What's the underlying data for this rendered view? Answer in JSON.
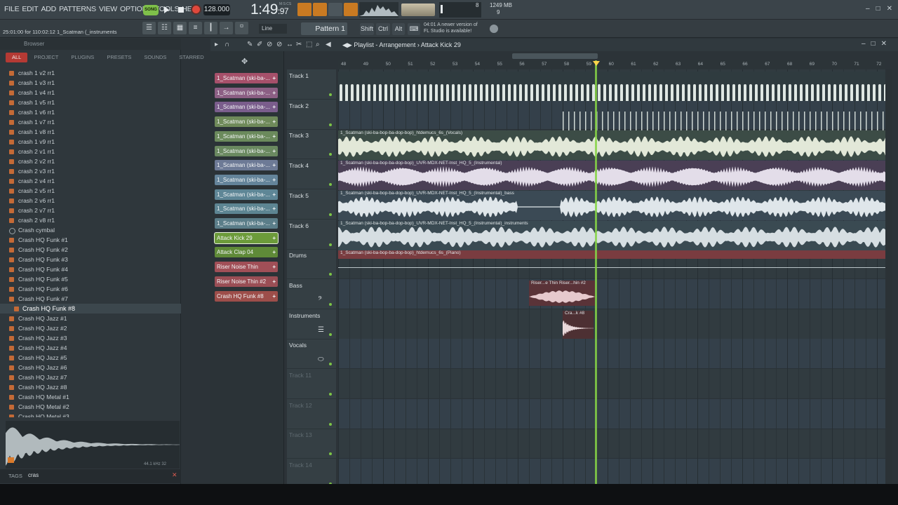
{
  "menu": [
    "FILE",
    "EDIT",
    "ADD",
    "PATTERNS",
    "VIEW",
    "OPTIONS",
    "TOOLS",
    "HELP"
  ],
  "transport": {
    "song_mode": "SONG",
    "tempo": "128.000",
    "time_main": "1:49",
    "time_sub": "97",
    "time_unit": "M:S:CS",
    "cpu_value": "8",
    "poly_value": "9",
    "memory": "1249 MB"
  },
  "toolbar": {
    "hint": "25:01:00 for 110:02:12  1_Scatman (_instruments",
    "snap": "Line",
    "pattern": "Pattern 1",
    "shift": "Shift",
    "ctrl": "Ctrl",
    "alt": "Alt",
    "news_line1": "04:01  A newer version of",
    "news_line2": "FL Studio is available!"
  },
  "browser": {
    "title": "Browser",
    "tabs": [
      "ALL",
      "PROJECT",
      "PLUGINS",
      "PRESETS",
      "SOUNDS",
      "STARRED"
    ],
    "items": [
      "crash 1 v2 rr1",
      "crash 1 v3 rr1",
      "crash 1 v4 rr1",
      "crash 1 v5 rr1",
      "crash 1 v6 rr1",
      "crash 1 v7 rr1",
      "crash 1 v8 rr1",
      "crash 1 v9 rr1",
      "crash 2 v1 rr1",
      "crash 2 v2 rr1",
      "crash 2 v3 rr1",
      "crash 2 v4 rr1",
      "crash 2 v5 rr1",
      "crash 2 v6 rr1",
      "crash 2 v7 rr1",
      "crash 2 v8 rr1",
      "Crash cymbal",
      "Crash HQ Funk #1",
      "Crash HQ Funk #2",
      "Crash HQ Funk #3",
      "Crash HQ Funk #4",
      "Crash HQ Funk #5",
      "Crash HQ Funk #6",
      "Crash HQ Funk #7",
      "Crash HQ Funk #8",
      "Crash HQ Jazz #1",
      "Crash HQ Jazz #2",
      "Crash HQ Jazz #3",
      "Crash HQ Jazz #4",
      "Crash HQ Jazz #5",
      "Crash HQ Jazz #6",
      "Crash HQ Jazz #7",
      "Crash HQ Jazz #8",
      "Crash HQ Metal #1",
      "Crash HQ Metal #2",
      "Crash HQ Metal #3"
    ],
    "selected_index": 24,
    "folder_index": 16,
    "preview_info": "44.1 kHz 32",
    "search_label": "TAGS",
    "search_value": "cras"
  },
  "playlist": {
    "title": "Playlist - Arrangement",
    "current_clip": "Attack Kick 29",
    "picker": [
      {
        "label": "1_Scatman (ski-ba-...",
        "color": "#a6506a"
      },
      {
        "label": "1_Scatman (ski-ba-...",
        "color": "#8c5f84"
      },
      {
        "label": "1_Scatman (ski-ba-...",
        "color": "#7a5d8c"
      },
      {
        "label": "1_Scatman (ski-ba-...",
        "color": "#6f8a5a"
      },
      {
        "label": "1_Scatman (ski-ba-...",
        "color": "#6b8a5c"
      },
      {
        "label": "1_Scatman (ski-ba-...",
        "color": "#6a8960"
      },
      {
        "label": "1_Scatman (ski-ba-...",
        "color": "#6d7a96"
      },
      {
        "label": "1_Scatman (ski-ba-...",
        "color": "#64849a"
      },
      {
        "label": "1_Scatman (ski-ba-...",
        "color": "#5e8696"
      },
      {
        "label": "1_Scatman (ski-ba-...",
        "color": "#5d8592"
      },
      {
        "label": "1_Scatman (ski-ba-...",
        "color": "#5b7e89"
      },
      {
        "label": "Attack Kick 29",
        "color": "#6c9b3a"
      },
      {
        "label": "Attack Clap 04",
        "color": "#5f8a38"
      },
      {
        "label": "Riser Noise Thin",
        "color": "#a14f57"
      },
      {
        "label": "Riser Noise Thin #2",
        "color": "#9a4e55"
      },
      {
        "label": "Crash HQ Funk #8",
        "color": "#9d4e4a"
      }
    ],
    "ruler": [
      "48",
      "49",
      "50",
      "51",
      "52",
      "53",
      "54",
      "55",
      "56",
      "57",
      "58",
      "59",
      "60",
      "61",
      "62",
      "63",
      "64",
      "65",
      "66",
      "67",
      "68",
      "69",
      "70",
      "71",
      "72"
    ],
    "tracks": [
      "Track 1",
      "Track 2",
      "Track 3",
      "Track 4",
      "Track 5",
      "Track 6",
      "Drums",
      "Bass",
      "Instruments",
      "Vocals",
      "Track 11",
      "Track 12",
      "Track 13",
      "Track 14"
    ],
    "clips": {
      "vocals": "1_Scatman (ski-ba-bop-ba-dop-bop)_htdemucs_6s_(Vocals)",
      "instrumental": "1_Scatman (ski-ba-bop-ba-dop-bop)_UVR-MDX-NET-Inst_HQ_5_(Instrumental)",
      "bass": "1_Scatman (ski-ba-bop-ba-dop-bop)_UVR-MDX-NET-Inst_HQ_5_(Instrumental)_bass",
      "instruments": "1_Scatman (ski-ba-bop-ba-dop-bop)_UVR-MDX-NET-Inst_HQ_5_(Instrumental)_instruments",
      "piano": "1_Scatman (ski-ba-bop-ba-dop-bop)_htdemucs_6s_(Piano)",
      "riser": "Riser...e Thin  Riser...hin #2",
      "crash": "Cra...k #8"
    }
  },
  "colors": {
    "accent_green": "#7fc04a",
    "record_red": "#e0483c",
    "transport_orange": "#c97a22",
    "playhead": "#86d346"
  }
}
